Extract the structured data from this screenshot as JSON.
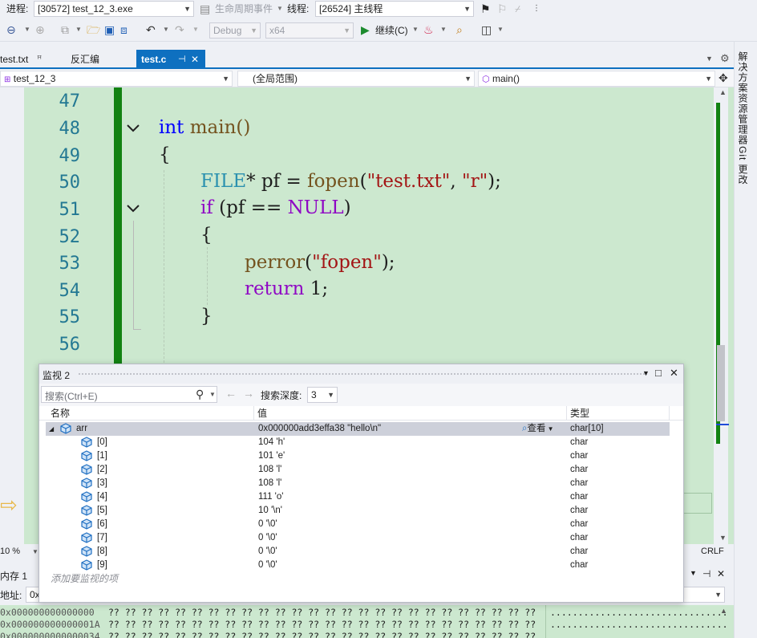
{
  "toolbar1": {
    "process_label": "进程:",
    "process_value": "[30572] test_12_3.exe",
    "lifecycle_label": "生命周期事件",
    "thread_label": "线程:",
    "thread_value": "[26524] 主线程"
  },
  "toolbar2": {
    "config_value": "Debug",
    "platform_value": "x64",
    "continue_label": "继续(C)"
  },
  "tabs": [
    {
      "label": "test.txt",
      "pin": "ꟸ"
    },
    {
      "label": "反汇编"
    },
    {
      "label": "test.c",
      "pin": "⊣",
      "close": "✕"
    }
  ],
  "navbar": {
    "project": "test_12_3",
    "scope": "(全局范围)",
    "member": "main()"
  },
  "editor": {
    "line_numbers": [
      "47",
      "48",
      "49",
      "50",
      "51",
      "52",
      "53",
      "54",
      "55",
      "56"
    ],
    "lines": {
      "l48_kw": "int",
      "l48_rest": " main()",
      "l49": "{",
      "l50_type": "FILE",
      "l50_a": "* pf = ",
      "l50_fn": "fopen",
      "l50_b": "(",
      "l50_s1": "\"test.txt\"",
      "l50_c": ", ",
      "l50_s2": "\"r\"",
      "l50_d": ");",
      "l51_kw": "if",
      "l51_a": " (pf == ",
      "l51_null": "NULL",
      "l51_b": ")",
      "l52": "{",
      "l53_fn": "perror",
      "l53_a": "(",
      "l53_s": "\"fopen\"",
      "l53_b": ");",
      "l54_kw": "return",
      "l54_a": " 1;",
      "l55": "}"
    }
  },
  "status": {
    "zoom": "10 %",
    "eol": "CRLF"
  },
  "memory": {
    "title": "内存 1",
    "addr_label": "地址:",
    "addr_value": "0x",
    "rows": [
      {
        "addr": "0x000000000000000",
        "bytes": "?? ?? ?? ?? ?? ?? ?? ?? ?? ?? ?? ?? ?? ?? ?? ?? ?? ?? ?? ?? ?? ?? ?? ?? ?? ??",
        "ascii": "................................"
      },
      {
        "addr": "0x000000000000001A",
        "bytes": "?? ?? ?? ?? ?? ?? ?? ?? ?? ?? ?? ?? ?? ?? ?? ?? ?? ?? ?? ?? ?? ?? ?? ?? ?? ??",
        "ascii": "................................"
      },
      {
        "addr": "0x0000000000000034",
        "bytes": "?? ?? ?? ?? ?? ?? ?? ?? ?? ?? ?? ?? ?? ?? ?? ?? ?? ?? ?? ?? ?? ?? ?? ?? ?? ??",
        "ascii": ""
      }
    ]
  },
  "right_panel": {
    "solution_explorer": "解决方案资源管理器",
    "git_changes": "Git 更改"
  },
  "watch": {
    "title": "监视 2",
    "search_placeholder": "搜索(Ctrl+E)",
    "search_depth_label": "搜索深度:",
    "search_depth_value": "3",
    "columns": {
      "name": "名称",
      "value": "值",
      "type": "类型"
    },
    "view_label": "查看",
    "add_item": "添加要监视的项",
    "rows": [
      {
        "name": "arr",
        "value": "0x000000add3effa38 \"hello\\n\"",
        "type": "char[10]",
        "expanded": true
      },
      {
        "name": "[0]",
        "value": "104 'h'",
        "type": "char"
      },
      {
        "name": "[1]",
        "value": "101 'e'",
        "type": "char"
      },
      {
        "name": "[2]",
        "value": "108 'l'",
        "type": "char"
      },
      {
        "name": "[3]",
        "value": "108 'l'",
        "type": "char"
      },
      {
        "name": "[4]",
        "value": "111 'o'",
        "type": "char"
      },
      {
        "name": "[5]",
        "value": "10 '\\n'",
        "type": "char"
      },
      {
        "name": "[6]",
        "value": "0 '\\0'",
        "type": "char"
      },
      {
        "name": "[7]",
        "value": "0 '\\0'",
        "type": "char"
      },
      {
        "name": "[8]",
        "value": "0 '\\0'",
        "type": "char"
      },
      {
        "name": "[9]",
        "value": "0 '\\0'",
        "type": "char"
      }
    ]
  }
}
